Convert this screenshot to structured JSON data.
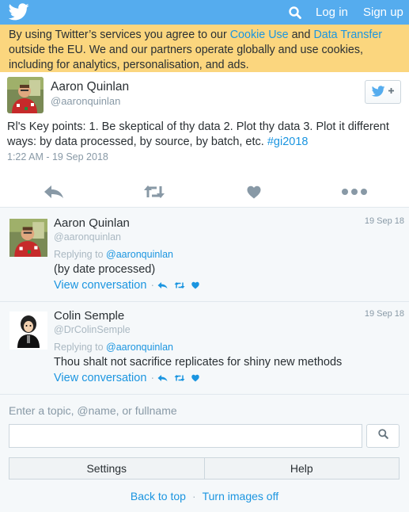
{
  "header": {
    "login_label": "Log in",
    "signup_label": "Sign up",
    "icons": {
      "logo": "twitter-bird-icon",
      "search": "search-icon"
    }
  },
  "cookie_banner": {
    "text_1": "By using Twitter’s services you agree to our ",
    "cookie_link": "Cookie Use",
    "text_2": " and ",
    "transfer_link": "Data Transfer",
    "text_3": " outside the EU. We and our partners operate globally and use cookies, including for analytics, personalisation, and ads."
  },
  "main_tweet": {
    "author_name": "Aaron Quinlan",
    "author_handle": "@aaronquinlan",
    "text": "Rl's Key points: 1. Be skeptical of thy data 2. Plot thy data 3. Plot it different ways: by data processed, by source, by batch, etc. ",
    "hashtag": "#gi2018",
    "timestamp": "1:22 AM - 19 Sep 2018",
    "actions": [
      "reply-icon",
      "retweet-icon",
      "like-icon",
      "more-icon"
    ]
  },
  "replies": [
    {
      "name": "Aaron Quinlan",
      "handle": "@aaronquinlan",
      "date": "19 Sep 18",
      "replying_prefix": "Replying to ",
      "replying_to": "@aaronquinlan",
      "text": "(by date processed)",
      "view_label": "View conversation",
      "separator": "·"
    },
    {
      "name": "Colin Semple",
      "handle": "@DrColinSemple",
      "date": "19 Sep 18",
      "replying_prefix": "Replying to ",
      "replying_to": "@aaronquinlan",
      "text": "Thou shalt not sacrifice replicates for shiny new methods",
      "view_label": "View conversation",
      "separator": "·"
    }
  ],
  "search": {
    "label": "Enter a topic, @name, or fullname",
    "placeholder": ""
  },
  "bottom_buttons": {
    "settings": "Settings",
    "help": "Help"
  },
  "footer": {
    "back_to_top": "Back to top",
    "separator": "·",
    "turn_images_off": "Turn images off"
  },
  "colors": {
    "brand": "#55acee",
    "link": "#1b95e0",
    "banner": "#fbd67e",
    "muted": "#8899a6"
  }
}
